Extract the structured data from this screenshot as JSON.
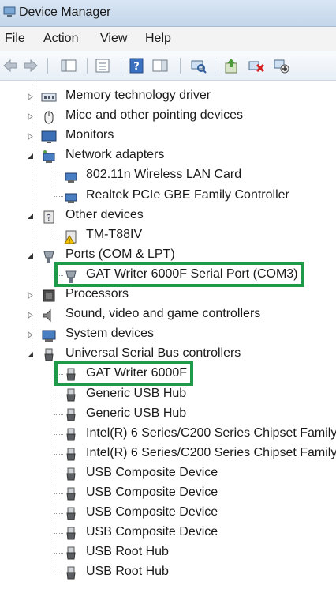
{
  "window": {
    "title": "Device Manager"
  },
  "menu": [
    "File",
    "Action",
    "View",
    "Help"
  ],
  "toolbar": {
    "buttons": [
      {
        "name": "back-arrow-icon"
      },
      {
        "name": "forward-arrow-icon"
      },
      {
        "name": "show-hide-console-tree-icon"
      },
      {
        "name": "properties-icon"
      },
      {
        "name": "help-icon"
      },
      {
        "name": "action-pane-icon"
      },
      {
        "name": "scan-hardware-changes-icon"
      },
      {
        "name": "update-driver-icon"
      },
      {
        "name": "uninstall-device-icon"
      },
      {
        "name": "disable-device-icon"
      }
    ]
  },
  "tree": [
    {
      "label": "Memory technology driver",
      "level": 1,
      "state": "collapsed",
      "icon": "memory-icon"
    },
    {
      "label": "Mice and other pointing devices",
      "level": 1,
      "state": "collapsed",
      "icon": "mouse-icon"
    },
    {
      "label": "Monitors",
      "level": 1,
      "state": "collapsed",
      "icon": "monitor-icon"
    },
    {
      "label": "Network adapters",
      "level": 1,
      "state": "expanded",
      "icon": "network-icon"
    },
    {
      "label": "802.11n Wireless LAN Card",
      "level": 2,
      "icon": "network-adapter-icon"
    },
    {
      "label": "Realtek PCIe GBE Family Controller",
      "level": 2,
      "icon": "network-adapter-icon"
    },
    {
      "label": "Other devices",
      "level": 1,
      "state": "expanded",
      "icon": "other-devices-icon"
    },
    {
      "label": "TM-T88IV",
      "level": 2,
      "icon": "warning-device-icon"
    },
    {
      "label": "Ports (COM & LPT)",
      "level": 1,
      "state": "expanded",
      "icon": "port-icon"
    },
    {
      "label": "GAT Writer 6000F Serial Port (COM3)",
      "level": 2,
      "icon": "port-icon",
      "highlighted": true
    },
    {
      "label": "Processors",
      "level": 1,
      "state": "collapsed",
      "icon": "processor-icon"
    },
    {
      "label": "Sound, video and game controllers",
      "level": 1,
      "state": "collapsed",
      "icon": "speaker-icon"
    },
    {
      "label": "System devices",
      "level": 1,
      "state": "collapsed",
      "icon": "system-icon"
    },
    {
      "label": "Universal Serial Bus controllers",
      "level": 1,
      "state": "expanded",
      "icon": "usb-icon"
    },
    {
      "label": "GAT Writer 6000F",
      "level": 2,
      "icon": "usb-icon",
      "highlighted": true
    },
    {
      "label": "Generic USB Hub",
      "level": 2,
      "icon": "usb-icon"
    },
    {
      "label": "Generic USB Hub",
      "level": 2,
      "icon": "usb-icon"
    },
    {
      "label": "Intel(R) 6 Series/C200 Series Chipset Family",
      "level": 2,
      "icon": "usb-icon"
    },
    {
      "label": "Intel(R) 6 Series/C200 Series Chipset Family",
      "level": 2,
      "icon": "usb-icon"
    },
    {
      "label": "USB Composite Device",
      "level": 2,
      "icon": "usb-icon"
    },
    {
      "label": "USB Composite Device",
      "level": 2,
      "icon": "usb-icon"
    },
    {
      "label": "USB Composite Device",
      "level": 2,
      "icon": "usb-icon"
    },
    {
      "label": "USB Composite Device",
      "level": 2,
      "icon": "usb-icon"
    },
    {
      "label": "USB Root Hub",
      "level": 2,
      "icon": "usb-icon"
    },
    {
      "label": "USB Root Hub",
      "level": 2,
      "icon": "usb-icon"
    }
  ],
  "colors": {
    "highlight_border": "#1f9a48",
    "title_bar": "#c4d6ea",
    "tree_lines": "#9a9a9a"
  }
}
